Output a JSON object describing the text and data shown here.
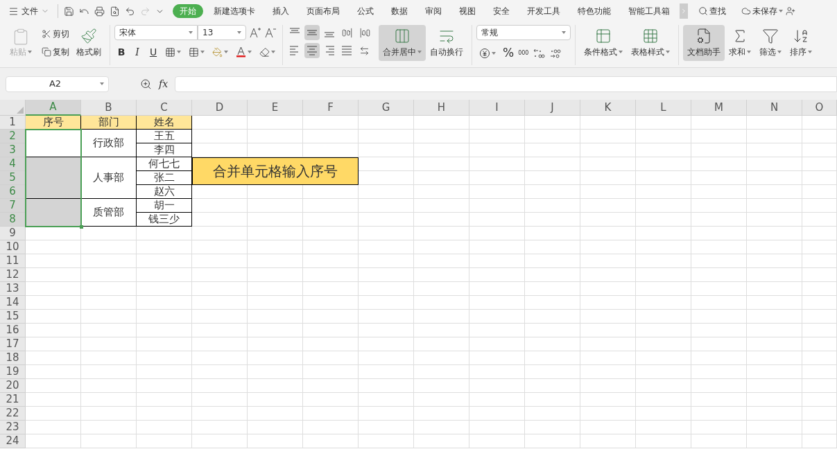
{
  "menu": {
    "file": "文件",
    "tabs": [
      {
        "label": "开始",
        "selected": true
      },
      {
        "label": "新建选项卡",
        "selected": false
      },
      {
        "label": "插入",
        "selected": false
      },
      {
        "label": "页面布局",
        "selected": false
      },
      {
        "label": "公式",
        "selected": false
      },
      {
        "label": "数据",
        "selected": false
      },
      {
        "label": "审阅",
        "selected": false
      },
      {
        "label": "视图",
        "selected": false
      },
      {
        "label": "安全",
        "selected": false
      },
      {
        "label": "开发工具",
        "selected": false
      },
      {
        "label": "特色功能",
        "selected": false
      },
      {
        "label": "智能工具箱",
        "selected": false
      }
    ],
    "find": "查找",
    "save_status": "未保存"
  },
  "ribbon": {
    "paste": {
      "label": "粘贴",
      "disabled": true
    },
    "cut": "剪切",
    "copy": "复制",
    "format_painter": "格式刷",
    "font": "宋体",
    "font_size": "13",
    "bold": "B",
    "italic": "I",
    "underline": "U",
    "vertical_align": [
      {
        "kind": "top",
        "selected": false
      },
      {
        "kind": "middle",
        "selected": true
      },
      {
        "kind": "bottom",
        "selected": false
      }
    ],
    "horizontal_align": [
      {
        "kind": "left",
        "selected": false
      },
      {
        "kind": "center",
        "selected": true
      },
      {
        "kind": "right",
        "selected": false
      },
      {
        "kind": "justify",
        "selected": false
      }
    ],
    "merge": {
      "label": "合并居中",
      "selected": true
    },
    "wrap": "自动换行",
    "number_format": "常规",
    "percent": "%",
    "thousands": "000",
    "cond_format": "条件格式",
    "table_style": "表格样式",
    "assistant": {
      "label": "文档助手",
      "selected": true
    },
    "sum": "求和",
    "filter": "筛选",
    "sort": "排序"
  },
  "name_box": "A2",
  "formula_label": "fx",
  "sheet": {
    "columns": [
      {
        "label": "A",
        "selected": true
      },
      {
        "label": "B",
        "selected": false
      },
      {
        "label": "C",
        "selected": false
      },
      {
        "label": "D",
        "selected": false
      },
      {
        "label": "E",
        "selected": false
      },
      {
        "label": "F",
        "selected": false
      },
      {
        "label": "G",
        "selected": false
      },
      {
        "label": "H",
        "selected": false
      },
      {
        "label": "I",
        "selected": false
      },
      {
        "label": "J",
        "selected": false
      },
      {
        "label": "K",
        "selected": false
      },
      {
        "label": "L",
        "selected": false
      },
      {
        "label": "M",
        "selected": false
      },
      {
        "label": "N",
        "selected": false
      },
      {
        "label": "O",
        "selected": false
      }
    ],
    "rows": [
      {
        "label": "1",
        "selected": false
      },
      {
        "label": "2",
        "selected": true
      },
      {
        "label": "3",
        "selected": true
      },
      {
        "label": "4",
        "selected": true
      },
      {
        "label": "5",
        "selected": true
      },
      {
        "label": "6",
        "selected": true
      },
      {
        "label": "7",
        "selected": true
      },
      {
        "label": "8",
        "selected": true
      },
      {
        "label": "9",
        "selected": false
      },
      {
        "label": "10",
        "selected": false
      },
      {
        "label": "11",
        "selected": false
      },
      {
        "label": "12",
        "selected": false
      },
      {
        "label": "13",
        "selected": false
      },
      {
        "label": "14",
        "selected": false
      },
      {
        "label": "15",
        "selected": false
      },
      {
        "label": "16",
        "selected": false
      },
      {
        "label": "17",
        "selected": false
      },
      {
        "label": "18",
        "selected": false
      },
      {
        "label": "19",
        "selected": false
      },
      {
        "label": "20",
        "selected": false
      },
      {
        "label": "21",
        "selected": false
      },
      {
        "label": "22",
        "selected": false
      },
      {
        "label": "23",
        "selected": false
      },
      {
        "label": "24",
        "selected": false
      }
    ],
    "table": {
      "header": {
        "number": "序号",
        "department": "部门",
        "name": "姓名"
      },
      "groups": [
        {
          "number_selected": true,
          "number_active": true,
          "department": "行政部",
          "names": [
            "王五",
            "李四"
          ]
        },
        {
          "number_selected": true,
          "number_active": false,
          "department": "人事部",
          "names": [
            "何七七",
            "张二",
            "赵六"
          ]
        },
        {
          "number_selected": true,
          "number_active": false,
          "department": "质管部",
          "names": [
            "胡一",
            "钱三少"
          ]
        }
      ]
    },
    "note": "合并单元格输入序号"
  }
}
